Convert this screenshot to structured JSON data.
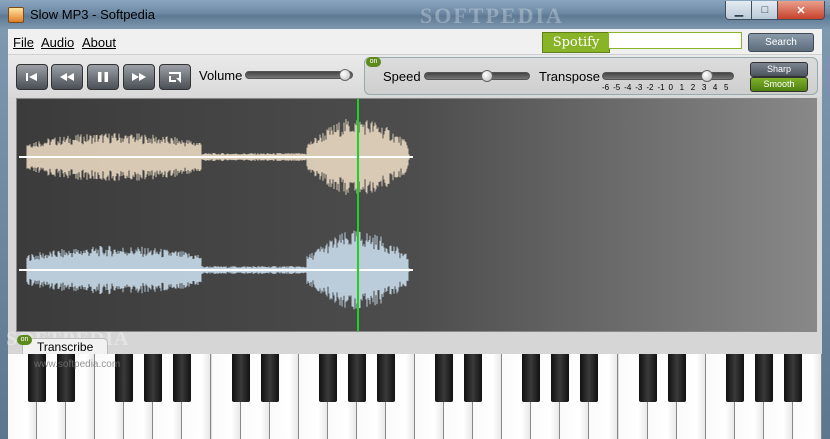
{
  "window": {
    "title": "Slow MP3 - Softpedia",
    "watermark": "SOFTPEDIA",
    "minimize_glyph": "▁",
    "maximize_glyph": "□",
    "close_glyph": "✕"
  },
  "menu": {
    "items": [
      {
        "label": "File"
      },
      {
        "label": "Audio"
      },
      {
        "label": "About"
      }
    ]
  },
  "spotify": {
    "logo": "Spotify",
    "search_value": "",
    "search_button": "Search",
    "accent_color": "#8ab428"
  },
  "transport": {
    "buttons": [
      "skip-back-icon",
      "rewind-icon",
      "pause-icon",
      "fast-forward-icon",
      "loop-icon"
    ],
    "volume_label": "Volume",
    "volume_level": 0.97
  },
  "speed": {
    "on_badge": "on",
    "label": "Speed",
    "level": 0.6
  },
  "transpose": {
    "label": "Transpose",
    "ticks": [
      "-6",
      "-5",
      "-4",
      "-3",
      "-2",
      "-1",
      "0",
      "1",
      "2",
      "3",
      "4",
      "5"
    ],
    "value": 3
  },
  "modes": {
    "sharp": "Sharp",
    "smooth": "Smooth",
    "selected": "Smooth"
  },
  "waveform": {
    "playhead_color": "#1fd21f",
    "top_channel_color": "#e8d8c0",
    "bottom_channel_color": "#c8dceb"
  },
  "transcribe": {
    "on_badge": "on",
    "label": "Transcribe"
  },
  "piano": {
    "white_key_count": 28
  },
  "watermark_bottom": "SOFTPEDIA",
  "watermark_url": "www.softpedia.com"
}
